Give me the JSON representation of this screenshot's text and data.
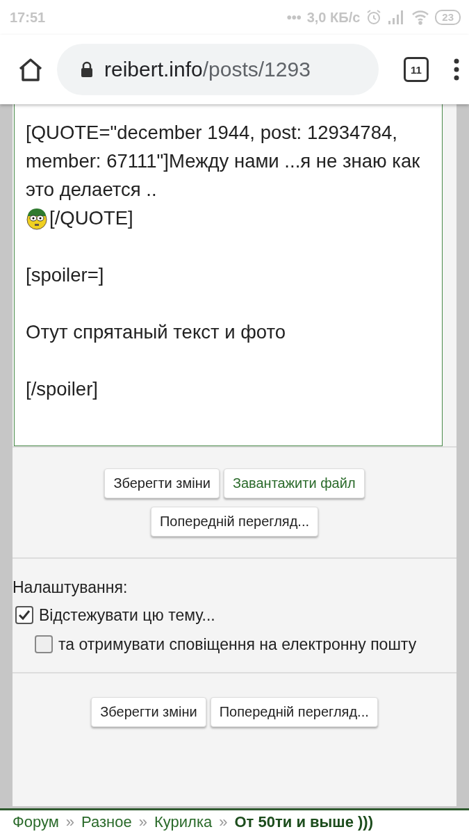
{
  "status_bar": {
    "time": "17:51",
    "dots": "•••",
    "speed": "3,0 КБ/с",
    "battery": "23"
  },
  "browser": {
    "url_host": "reibert.info",
    "url_path": "/posts/1293",
    "tab_count": "11"
  },
  "editor": {
    "lines": [
      {
        "kind": "text",
        "text": "[QUOTE=\"december 1944, post: 12934784, member: 67111\"]Между нами ...я не знаю как это делается .."
      },
      {
        "kind": "smiley",
        "text": "[/QUOTE]"
      },
      {
        "kind": "text",
        "text": "[spoiler=]"
      },
      {
        "kind": "text",
        "text": "Отут спрятаный текст и фото"
      },
      {
        "kind": "text",
        "text": "[/spoiler]"
      }
    ]
  },
  "actions": [
    {
      "label": "Зберегти зміни",
      "kind": "normal"
    },
    {
      "label": "Завантажити файл",
      "kind": "accent"
    },
    {
      "label": "Попередній перегляд...",
      "kind": "normal"
    }
  ],
  "settings": {
    "title": "Налаштування:",
    "options": [
      {
        "label": "Відстежувати цю тему...",
        "checked": true,
        "kind": "main"
      },
      {
        "label": "та отримувати сповіщення на електронну пошту",
        "checked": false,
        "kind": "sub"
      }
    ]
  },
  "bottom_actions": [
    {
      "label": "Зберегти зміни",
      "kind": "normal"
    },
    {
      "label": "Попередній перегляд...",
      "kind": "normal"
    }
  ],
  "breadcrumb": [
    {
      "label": "Форум",
      "current": false
    },
    {
      "label": "Разное",
      "current": false
    },
    {
      "label": "Курилка",
      "current": false
    },
    {
      "label": "От 50ти и выше )))",
      "current": true
    }
  ],
  "breadcrumb_separator": "»"
}
